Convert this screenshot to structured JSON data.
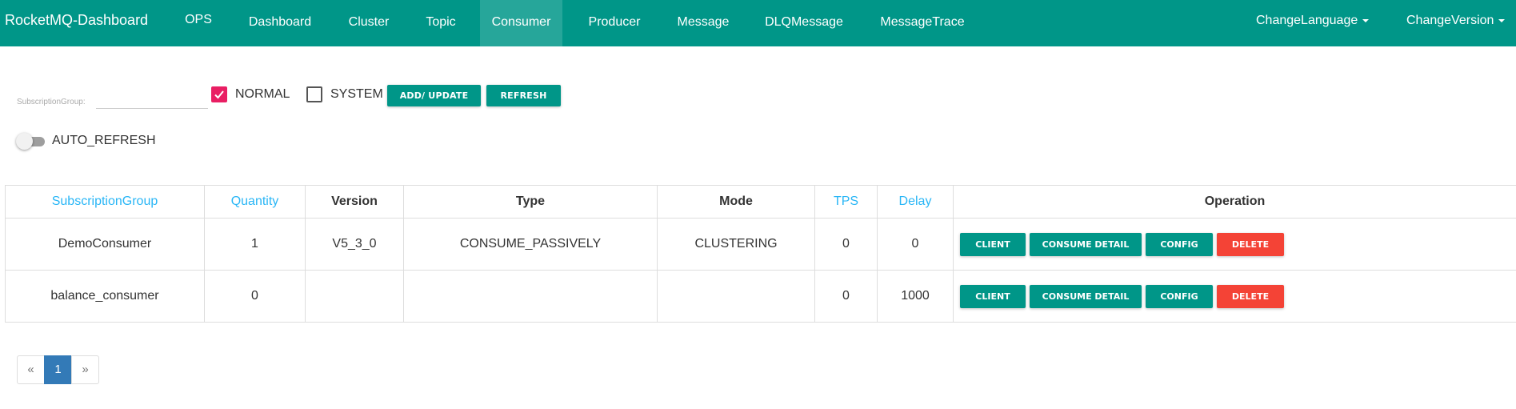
{
  "navbar": {
    "brand": "RocketMQ-Dashboard",
    "items": [
      {
        "label": "OPS"
      },
      {
        "label": "Dashboard"
      },
      {
        "label": "Cluster"
      },
      {
        "label": "Topic"
      },
      {
        "label": "Consumer",
        "active": true
      },
      {
        "label": "Producer"
      },
      {
        "label": "Message"
      },
      {
        "label": "DLQMessage"
      },
      {
        "label": "MessageTrace"
      }
    ],
    "change_language": "ChangeLanguage",
    "change_version": "ChangeVersion",
    "bg_color": "#009688"
  },
  "filters": {
    "subscription_group_label": "SubscriptionGroup:",
    "subscription_group_value": "",
    "normal_label": "NORMAL",
    "normal_checked": true,
    "system_label": "SYSTEM",
    "system_checked": false,
    "add_update_label": "ADD/ UPDATE",
    "refresh_label": "REFRESH",
    "auto_refresh_label": "AUTO_REFRESH",
    "auto_refresh_on": false
  },
  "table": {
    "headers": {
      "subscription_group": "SubscriptionGroup",
      "quantity": "Quantity",
      "version": "Version",
      "type": "Type",
      "mode": "Mode",
      "tps": "TPS",
      "delay": "Delay",
      "operation": "Operation"
    },
    "rows": [
      {
        "group": "DemoConsumer",
        "quantity": "1",
        "version": "V5_3_0",
        "type": "CONSUME_PASSIVELY",
        "mode": "CLUSTERING",
        "tps": "0",
        "delay": "0"
      },
      {
        "group": "balance_consumer",
        "quantity": "0",
        "version": "",
        "type": "",
        "mode": "",
        "tps": "0",
        "delay": "1000"
      }
    ],
    "operations": {
      "client": "CLIENT",
      "consume_detail": "CONSUME DETAIL",
      "config": "CONFIG",
      "delete": "DELETE"
    }
  },
  "pagination": {
    "prev": "«",
    "current": "1",
    "next": "»"
  },
  "colors": {
    "primary": "#009688",
    "danger": "#f44336",
    "checkbox": "#e91e63",
    "sortable_header": "#29b6f6",
    "page_active": "#337ab7"
  }
}
